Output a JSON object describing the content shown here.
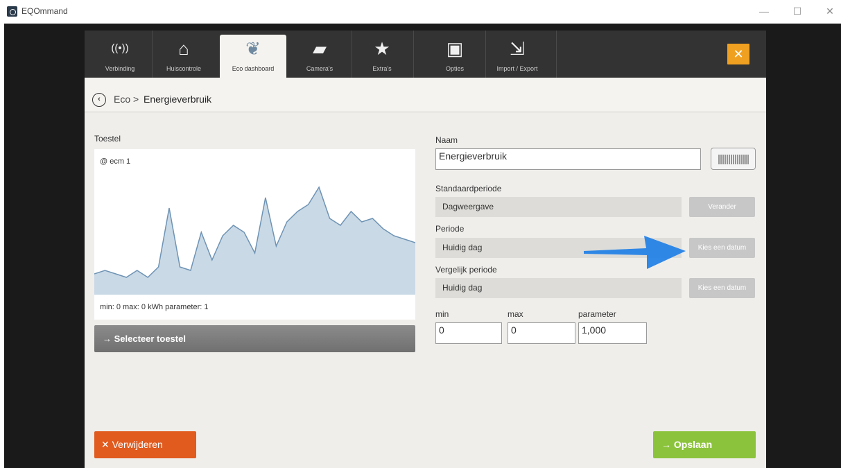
{
  "window": {
    "title": "EQOmmand",
    "minimize": "—",
    "maximize": "☐",
    "close": "✕"
  },
  "tabs": [
    {
      "label": "Verbinding",
      "icon": "wifi-icon",
      "glyph": "((•))"
    },
    {
      "label": "Huiscontrole",
      "icon": "home-icon",
      "glyph": "⌂"
    },
    {
      "label": "Eco dashboard",
      "icon": "leaf-icon",
      "glyph": "❦"
    },
    {
      "label": "Camera's",
      "icon": "camera-icon",
      "glyph": "▰"
    },
    {
      "label": "Extra's",
      "icon": "star-icon",
      "glyph": "★"
    },
    {
      "label": "Opties",
      "icon": "options-icon",
      "glyph": "▣"
    },
    {
      "label": "Import / Export",
      "icon": "import-export-icon",
      "glyph": "⇲"
    }
  ],
  "close_glyph": "✕",
  "breadcrumb": {
    "back": "‹",
    "root": "Eco",
    "separator": ">",
    "current": "Energieverbruik"
  },
  "left": {
    "device_label": "Toestel",
    "device_name": "@ ecm 1",
    "info": "min: 0 max: 0 kWh parameter: 1",
    "select_button": "→  Selecteer toestel"
  },
  "chart_data": {
    "type": "area",
    "values": [
      6,
      7,
      6,
      5,
      7,
      5,
      8,
      25,
      8,
      7,
      18,
      10,
      17,
      20,
      18,
      12,
      28,
      14,
      21,
      24,
      26,
      31,
      22,
      20,
      24,
      21,
      22,
      19,
      17,
      16,
      15
    ]
  },
  "right": {
    "name_label": "Naam",
    "name_value": "Energieverbruik",
    "standard_period_label": "Standaardperiode",
    "standard_period_value": "Dagweergave",
    "change_button": "Verander",
    "period_label": "Periode",
    "period_value": "Huidig dag",
    "pick_date_button": "Kies een datum",
    "compare_label": "Vergelijk periode",
    "compare_value": "Huidig dag",
    "compare_pick_button": "Kies een datum",
    "min_label": "min",
    "min_value": "0",
    "max_label": "max",
    "max_value": "0",
    "parameter_label": "parameter",
    "parameter_value": "1,000"
  },
  "footer": {
    "delete_button": "✕  Verwijderen",
    "save_button": "→  Opslaan"
  },
  "colors": {
    "accent_orange": "#f0a020",
    "delete_red": "#e15b1f",
    "save_green": "#8cc33c",
    "chart_fill": "#c9d9e6",
    "chart_line": "#6e93b4",
    "annotation_blue": "#1f7fe6"
  }
}
